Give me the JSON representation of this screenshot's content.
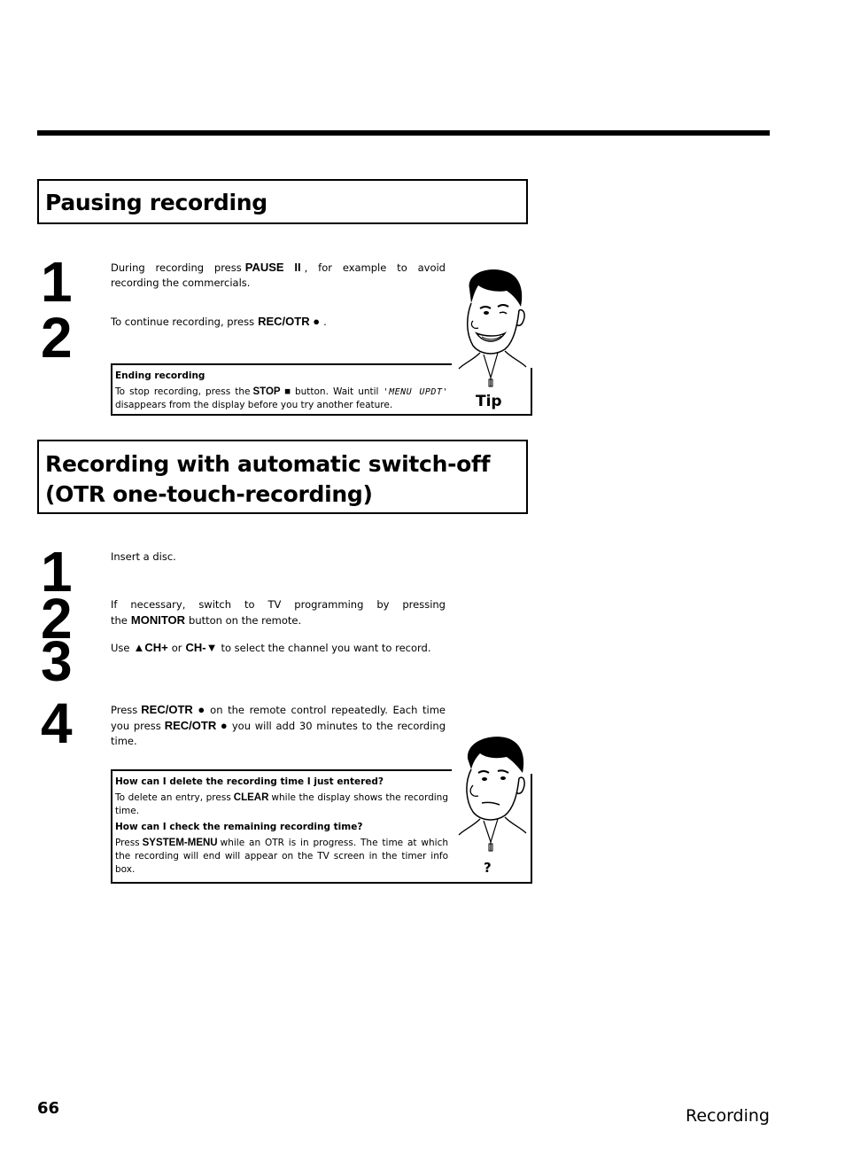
{
  "sections": [
    {
      "title": "Pausing recording",
      "steps": [
        {
          "number": "1",
          "text_before": "During recording press",
          "key": "PAUSE II",
          "text_after": ", for example to avoid recording the commercials."
        },
        {
          "number": "2",
          "text_before": "To continue recording, press",
          "key": "REC/OTR ●",
          "text_after": "."
        }
      ],
      "tip": {
        "label": "Tip",
        "icon": "smiling-man-icon",
        "heading": "Ending recording",
        "text_before": "To stop recording, press the",
        "key": "STOP ■",
        "text_middle": "button. Wait until",
        "display_text": "'MENU UPDT'",
        "text_after": "disappears from the display before you try another feature."
      }
    },
    {
      "title": "Recording with automatic switch-off (OTR one-touch-recording)",
      "steps": [
        {
          "number": "1",
          "text": "Insert a disc."
        },
        {
          "number": "2",
          "text_before": "If necessary, switch to TV programming by pressing the",
          "key": "MONITOR",
          "text_after": "button on the remote."
        },
        {
          "number": "3",
          "text_before": "Use",
          "key1": "▲CH+",
          "text_middle": "or",
          "key2": "CH-▼",
          "text_after": "to select the channel you want to record."
        },
        {
          "number": "4",
          "text_before": "Press",
          "key": "REC/OTR ●",
          "text_middle": "on the remote control repeatedly. Each time you press",
          "text_after": "you will add 30 minutes to the recording time."
        }
      ],
      "faq": {
        "label": "?",
        "icon": "puzzled-man-icon",
        "items": [
          {
            "question": "How can I delete the recording time I just entered?",
            "text_before": "To delete an entry, press",
            "key": "CLEAR",
            "text_after": "while the display shows the recording time."
          },
          {
            "question": "How can I check the remaining recording time?",
            "text_before": "Press",
            "key": "SYSTEM-MENU",
            "text_after": "while an OTR is in progress. The time at which the recording will end will appear on the TV screen in the timer info box."
          }
        ]
      }
    }
  ],
  "footer": {
    "page_number": "66",
    "section_name": "Recording"
  }
}
